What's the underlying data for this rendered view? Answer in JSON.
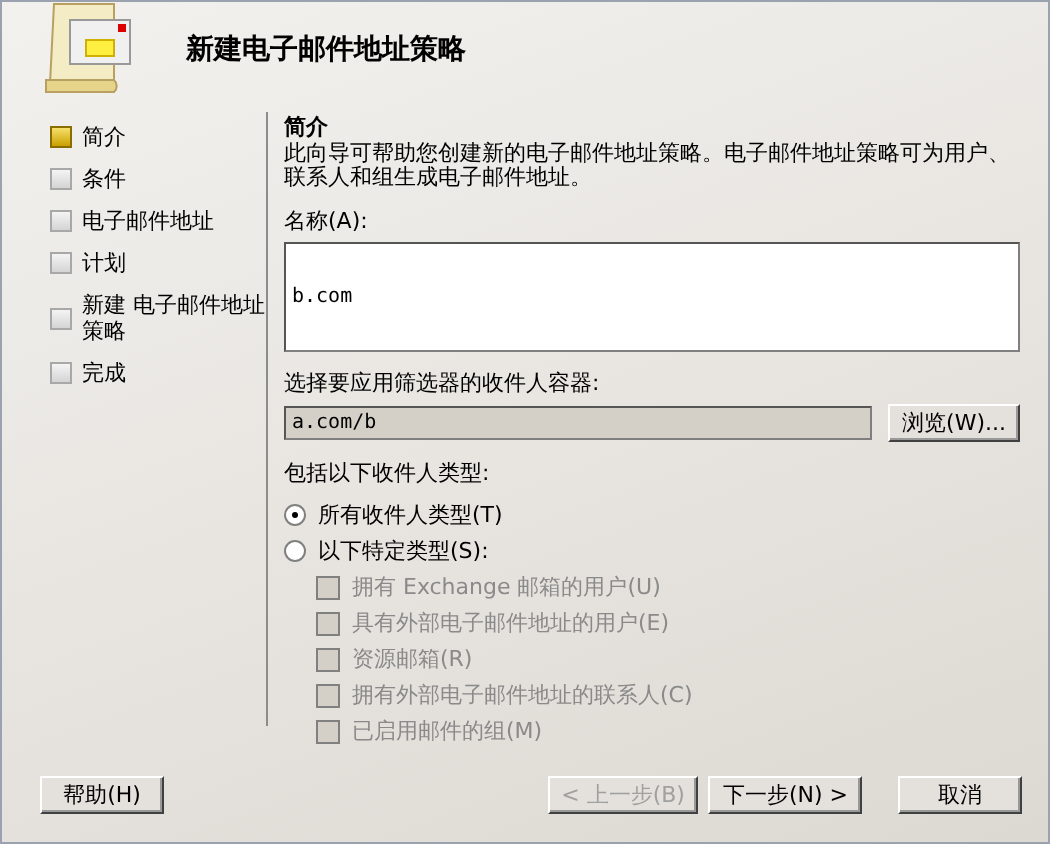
{
  "window": {
    "title": "新建电子邮件地址策略"
  },
  "steps": [
    {
      "label": "简介",
      "selected": true
    },
    {
      "label": "条件",
      "selected": false
    },
    {
      "label": "电子邮件地址",
      "selected": false
    },
    {
      "label": "计划",
      "selected": false
    },
    {
      "label": "新建 电子邮件地址策略",
      "selected": false
    },
    {
      "label": "完成",
      "selected": false
    }
  ],
  "intro": {
    "heading": "简介",
    "description": "此向导可帮助您创建新的电子邮件地址策略。电子邮件地址策略可为用户、联系人和组生成电子邮件地址。"
  },
  "name_field": {
    "label": "名称(A):",
    "value": "b.com"
  },
  "container_field": {
    "label": "选择要应用筛选器的收件人容器:",
    "value": "a.com/b",
    "browse_button": "浏览(W)..."
  },
  "recipient_types": {
    "label": "包括以下收件人类型:",
    "options": [
      {
        "label": "所有收件人类型(T)",
        "selected": true
      },
      {
        "label": "以下特定类型(S):",
        "selected": false
      }
    ],
    "types": [
      {
        "label": "拥有 Exchange 邮箱的用户(U)",
        "checked": false,
        "disabled": true
      },
      {
        "label": "具有外部电子邮件地址的用户(E)",
        "checked": false,
        "disabled": true
      },
      {
        "label": "资源邮箱(R)",
        "checked": false,
        "disabled": true
      },
      {
        "label": "拥有外部电子邮件地址的联系人(C)",
        "checked": false,
        "disabled": true
      },
      {
        "label": "已启用邮件的组(M)",
        "checked": false,
        "disabled": true
      }
    ]
  },
  "buttons": {
    "help": {
      "label": "帮助(H)",
      "disabled": false
    },
    "back": {
      "label": "< 上一步(B)",
      "disabled": true
    },
    "next": {
      "label": "下一步(N) >",
      "disabled": false
    },
    "cancel": {
      "label": "取消",
      "disabled": false
    }
  }
}
